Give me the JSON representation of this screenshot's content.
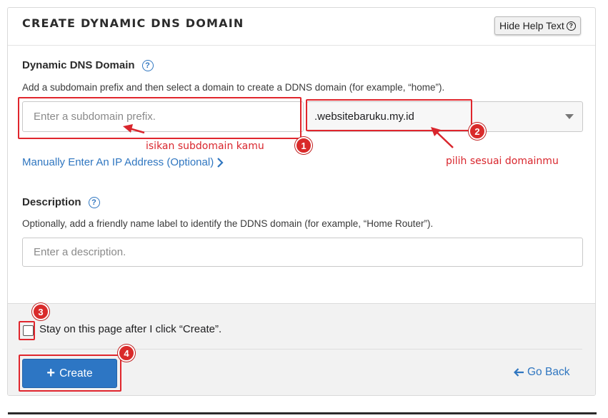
{
  "header": {
    "title": "CREATE DYNAMIC DNS DOMAIN",
    "help_button_label": "Hide Help Text"
  },
  "domain_field": {
    "label": "Dynamic DNS Domain",
    "help_text": "Add a subdomain prefix and then select a domain to create a DDNS domain (for example, “home”).",
    "prefix_placeholder": "Enter a subdomain prefix.",
    "selected_domain": ".websitebaruku.my.id"
  },
  "manual_ip_link": "Manually Enter An IP Address (Optional)",
  "description_field": {
    "label": "Description",
    "help_text": "Optionally, add a friendly name label to identify the DDNS domain (for example, “Home Router”).",
    "placeholder": "Enter a description."
  },
  "footer": {
    "stay_checkbox_label": "Stay on this page after I click “Create”.",
    "stay_checked": false,
    "create_label": "Create",
    "go_back_label": "Go Back"
  },
  "annotations": {
    "color": "#e0262d",
    "badges": [
      "1",
      "2",
      "3",
      "4"
    ],
    "subdomain_note": "isikan subdomain kamu",
    "domain_note": "pilih sesuai domainmu"
  },
  "colors": {
    "accent": "#2d76c4",
    "link": "#2f76c0",
    "footer_bg": "#f2f2f2"
  }
}
